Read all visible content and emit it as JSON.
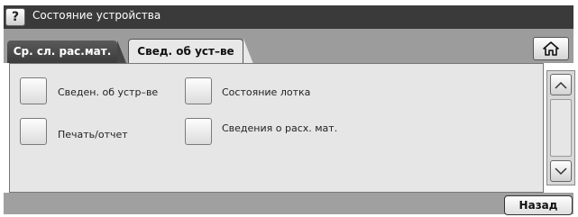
{
  "titlebar": {
    "help_label": "?",
    "title": "Состояние устройства"
  },
  "tabs": [
    {
      "label": "Ср. сл. рас.мат.",
      "active": false
    },
    {
      "label": "Свед. об уст–ве",
      "active": true
    }
  ],
  "toolbar": {
    "home_icon": "home-icon"
  },
  "options": [
    {
      "label": "Сведен. об устр–ве"
    },
    {
      "label": "Печать/отчет"
    },
    {
      "label": "Состояние лотка"
    },
    {
      "label": "Сведения о расх. мат."
    }
  ],
  "scroll": {
    "up_icon": "chevron-up-icon",
    "down_icon": "chevron-down-icon"
  },
  "footer": {
    "back_label": "Назад"
  },
  "colors": {
    "titlebar": "#3a3a3a",
    "tabstrip": "#9c9c9c",
    "panel": "#e6e6e6"
  }
}
